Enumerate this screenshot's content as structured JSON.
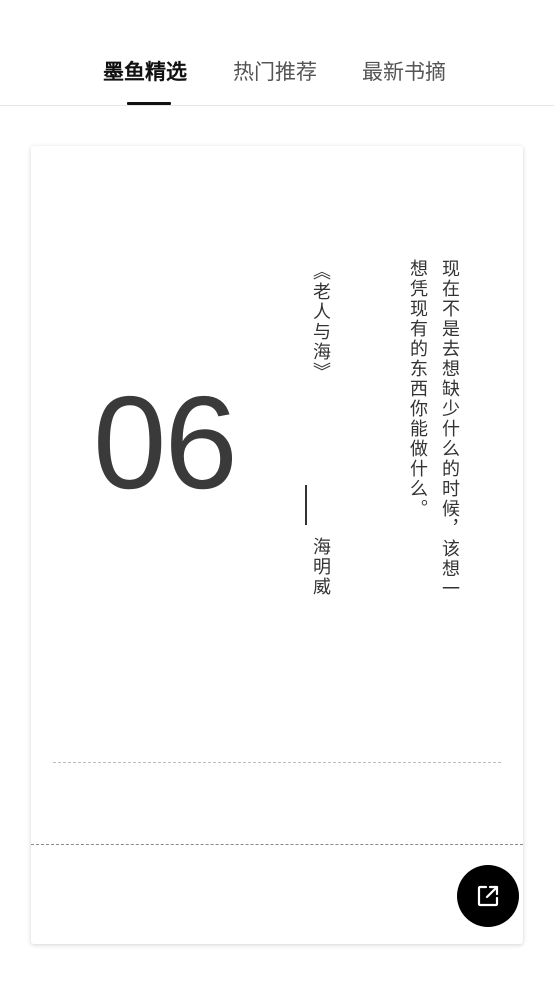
{
  "tabs": [
    {
      "label": "墨鱼精选",
      "active": true
    },
    {
      "label": "热门推荐",
      "active": false
    },
    {
      "label": "最新书摘",
      "active": false
    }
  ],
  "card": {
    "day": "06",
    "quote": "现在不是去想缺少什么的时候，该想一想凭现有的东西你能做什么。",
    "book": "《老人与海》",
    "author": "海明威"
  },
  "icons": {
    "share": "share-external-icon"
  }
}
